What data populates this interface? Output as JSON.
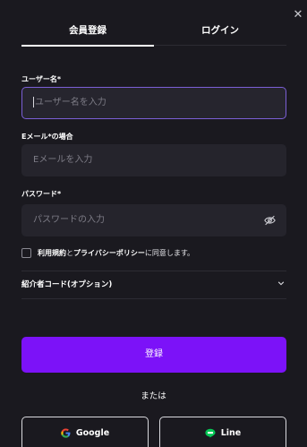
{
  "tabs": {
    "register": "会員登録",
    "login": "ログイン",
    "active": "register"
  },
  "username": {
    "label": "ユーザー名*",
    "placeholder": "ユーザー名を入力"
  },
  "email": {
    "label": "Eメール*の場合",
    "placeholder": "Eメールを入力"
  },
  "password": {
    "label": "パスワード*",
    "placeholder": "パスワードの入力"
  },
  "agreement": {
    "terms_link": "利用規約",
    "and": "と",
    "privacy_link": "プライバシーポリシー",
    "suffix": "に同意します。"
  },
  "referral": {
    "label": "紹介者コード(オプション)"
  },
  "register_button": "登録",
  "or_text": "または",
  "social": {
    "google": "Google",
    "line": "Line"
  },
  "icons": [
    "close-icon",
    "eye-off-icon",
    "chevron-down-icon",
    "google-icon",
    "line-icon"
  ],
  "colors": {
    "accent": "#7c12f8",
    "focus_border": "#7b5fd6",
    "background": "#1a191f",
    "field": "#25242c"
  }
}
